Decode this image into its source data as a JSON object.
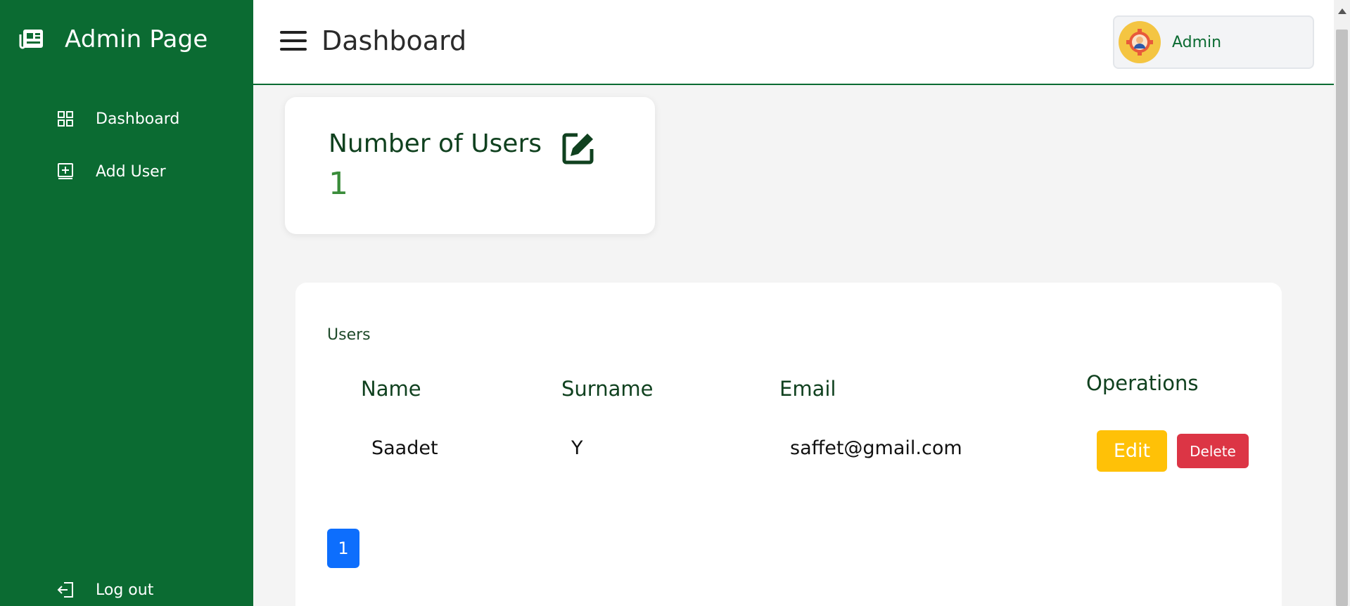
{
  "sidebar": {
    "brand_icon": "newspaper-icon",
    "brand_title": "Admin Page",
    "items": [
      {
        "label": "Dashboard",
        "icon": "grid-icon"
      },
      {
        "label": "Add User",
        "icon": "plus-square-icon"
      }
    ],
    "logout": {
      "label": "Log out",
      "icon": "logout-icon"
    },
    "background_color": "#0b6b32"
  },
  "header": {
    "menu_icon": "hamburger-menu-icon",
    "title": "Dashboard",
    "profile": {
      "name": "Admin",
      "avatar": "admin-avatar-icon"
    }
  },
  "stat_card": {
    "label": "Number of Users",
    "value": "1",
    "icon": "edit-square-icon"
  },
  "users_table": {
    "caption": "Users",
    "columns": [
      "Name",
      "Surname",
      "Email",
      "Operations"
    ],
    "rows": [
      {
        "name": "Saadet",
        "surname": "Y",
        "email": "saffet@gmail.com"
      }
    ],
    "edit_label": "Edit",
    "delete_label": "Delete",
    "edit_color": "#ffc107",
    "delete_color": "#dc3545"
  },
  "pagination": {
    "pages": [
      "1"
    ],
    "active_color": "#0d6efd"
  }
}
